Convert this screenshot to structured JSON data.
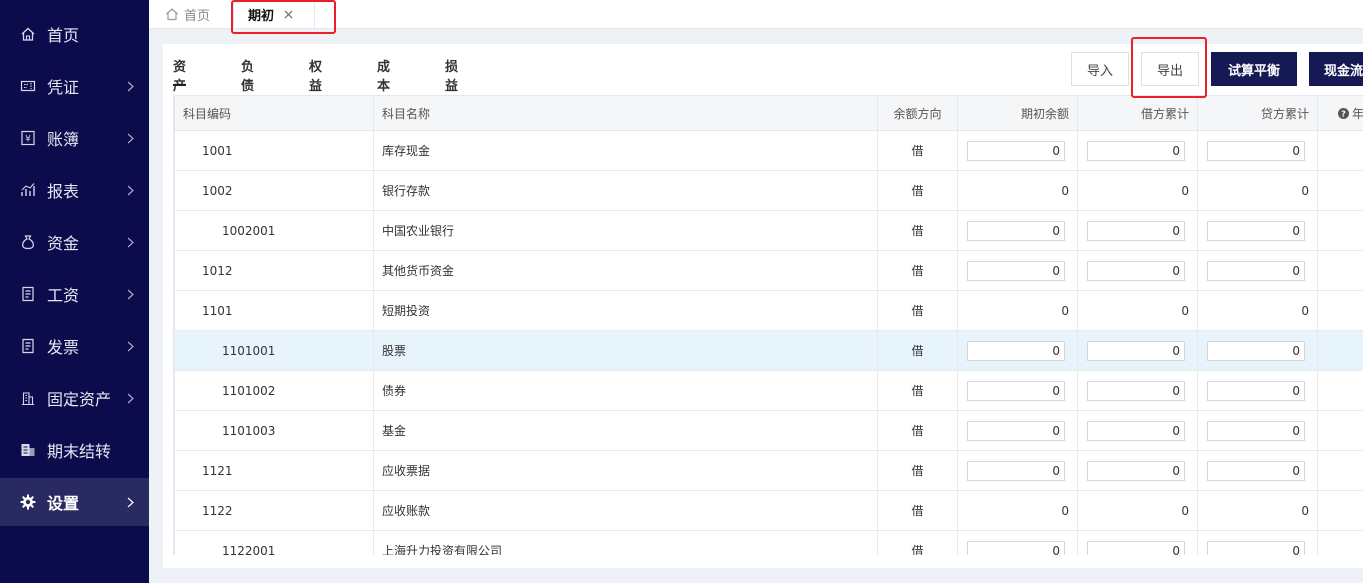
{
  "sidebar": {
    "items": [
      {
        "label": "首页",
        "icon": "home-icon",
        "arrow": false
      },
      {
        "label": "凭证",
        "icon": "voucher-icon",
        "arrow": true
      },
      {
        "label": "账簿",
        "icon": "ledger-icon",
        "arrow": true
      },
      {
        "label": "报表",
        "icon": "report-icon",
        "arrow": true
      },
      {
        "label": "资金",
        "icon": "money-bag-icon",
        "arrow": true
      },
      {
        "label": "工资",
        "icon": "salary-icon",
        "arrow": true
      },
      {
        "label": "发票",
        "icon": "invoice-icon",
        "arrow": true
      },
      {
        "label": "固定资产",
        "icon": "building-icon",
        "arrow": true
      },
      {
        "label": "期末结转",
        "icon": "period-close-icon",
        "arrow": false
      },
      {
        "label": "设置",
        "icon": "gear-icon",
        "arrow": true,
        "active": true
      }
    ]
  },
  "tabs": {
    "home": "首页",
    "active": "期初"
  },
  "subtabs": [
    "资产",
    "负债",
    "权益",
    "成本",
    "损益"
  ],
  "buttons": {
    "import": "导入",
    "export": "导出",
    "trial_balance": "试算平衡",
    "cashflow": "现金流"
  },
  "table": {
    "headers": {
      "code": "科目编码",
      "name": "科目名称",
      "direction": "余额方向",
      "opening": "期初余额",
      "debit": "借方累计",
      "credit": "贷方累计",
      "extra": "年"
    },
    "rows": [
      {
        "code": "1001",
        "name": "库存现金",
        "direction": "借",
        "opening": "0",
        "debit": "0",
        "credit": "0"
      },
      {
        "code": "1002",
        "name": "银行存款",
        "direction": "借",
        "opening": "0",
        "debit": "0",
        "credit": "0"
      },
      {
        "code": "1002001",
        "name": "中国农业银行",
        "direction": "借",
        "opening": "0",
        "debit": "0",
        "credit": "0"
      },
      {
        "code": "1012",
        "name": "其他货币资金",
        "direction": "借",
        "opening": "0",
        "debit": "0",
        "credit": "0"
      },
      {
        "code": "1101",
        "name": "短期投资",
        "direction": "借",
        "opening": "0",
        "debit": "0",
        "credit": "0"
      },
      {
        "code": "1101001",
        "name": "股票",
        "direction": "借",
        "opening": "0",
        "debit": "0",
        "credit": "0"
      },
      {
        "code": "1101002",
        "name": "债券",
        "direction": "借",
        "opening": "0",
        "debit": "0",
        "credit": "0"
      },
      {
        "code": "1101003",
        "name": "基金",
        "direction": "借",
        "opening": "0",
        "debit": "0",
        "credit": "0"
      },
      {
        "code": "1121",
        "name": "应收票据",
        "direction": "借",
        "opening": "0",
        "debit": "0",
        "credit": "0"
      },
      {
        "code": "1122",
        "name": "应收账款",
        "direction": "借",
        "opening": "0",
        "debit": "0",
        "credit": "0"
      },
      {
        "code": "1122001",
        "name": "上海升力投资有限公司",
        "direction": "借",
        "opening": "0",
        "debit": "0",
        "credit": "0"
      }
    ]
  }
}
